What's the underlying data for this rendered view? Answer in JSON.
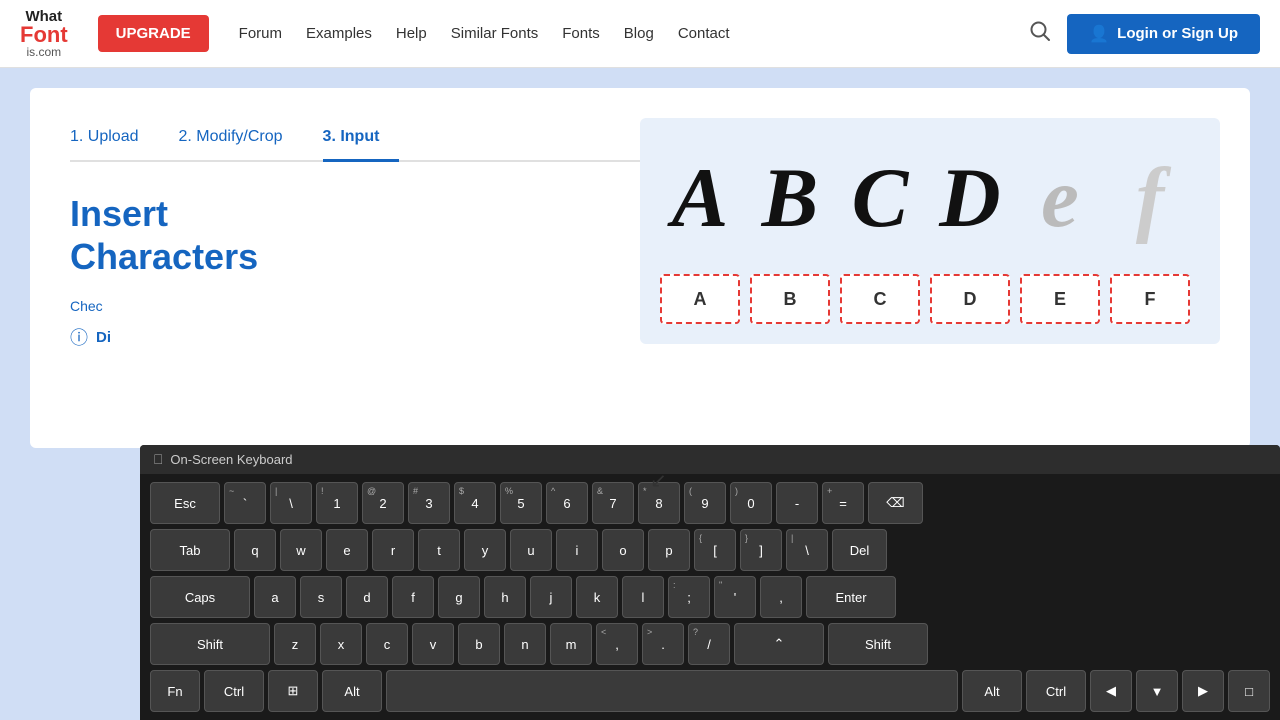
{
  "header": {
    "logo_what": "What",
    "logo_font": "Font",
    "logo_is": "is.com",
    "upgrade_label": "UPGRADE",
    "nav_items": [
      {
        "label": "Forum",
        "href": "#"
      },
      {
        "label": "Examples",
        "href": "#"
      },
      {
        "label": "Help",
        "href": "#"
      },
      {
        "label": "Similar Fonts",
        "href": "#"
      },
      {
        "label": "Fonts",
        "href": "#"
      },
      {
        "label": "Blog",
        "href": "#"
      },
      {
        "label": "Contact",
        "href": "#"
      }
    ],
    "login_label": "Login or Sign Up"
  },
  "steps": [
    {
      "label": "1. Upload",
      "active": false
    },
    {
      "label": "2. Modify/Crop",
      "active": false
    },
    {
      "label": "3. Input",
      "active": true
    }
  ],
  "main": {
    "title_line1": "Insert",
    "title_line2": "Characters",
    "check_text": "Chec",
    "di_text": "Di"
  },
  "char_panel": {
    "preview_chars": [
      {
        "char": "A",
        "faded": false
      },
      {
        "char": "B",
        "faded": false
      },
      {
        "char": "C",
        "faded": false
      },
      {
        "char": "D",
        "faded": false
      },
      {
        "char": "e",
        "faded": true
      },
      {
        "char": "f",
        "faded": true
      }
    ],
    "input_chars": [
      "A",
      "B",
      "C",
      "D",
      "E",
      "F"
    ]
  },
  "keyboard": {
    "title": "On-Screen Keyboard",
    "rows": [
      {
        "keys": [
          {
            "label": "Esc",
            "class": "wide"
          },
          {
            "label": "-",
            "sub": ""
          },
          {
            "label": "\\",
            "sub": ""
          },
          {
            "label": "1",
            "sub": "!"
          },
          {
            "label": "2",
            "sub": "@"
          },
          {
            "label": "3",
            "sub": "#"
          },
          {
            "label": "4",
            "sub": "$"
          },
          {
            "label": "5",
            "sub": "%"
          },
          {
            "label": "6",
            "sub": "^"
          },
          {
            "label": "7",
            "sub": "&"
          },
          {
            "label": "8",
            "sub": "*"
          },
          {
            "label": "9",
            "sub": "("
          },
          {
            "label": "0",
            "sub": ")"
          },
          {
            "label": "-",
            "sub": ""
          },
          {
            "label": "=",
            "sub": "+"
          },
          {
            "label": "⌫",
            "class": "backspace-key"
          }
        ]
      },
      {
        "keys": [
          {
            "label": "Tab",
            "class": "tab-key"
          },
          {
            "label": "q"
          },
          {
            "label": "w"
          },
          {
            "label": "e"
          },
          {
            "label": "r"
          },
          {
            "label": "t"
          },
          {
            "label": "y"
          },
          {
            "label": "u"
          },
          {
            "label": "i"
          },
          {
            "label": "o"
          },
          {
            "label": "p"
          },
          {
            "label": "{",
            "sub": "["
          },
          {
            "label": "}",
            "sub": "]"
          },
          {
            "label": "|",
            "sub": "\\"
          },
          {
            "label": "Del",
            "class": "del-key"
          }
        ]
      },
      {
        "keys": [
          {
            "label": "Caps",
            "class": "caps"
          },
          {
            "label": "a"
          },
          {
            "label": "s"
          },
          {
            "label": "d"
          },
          {
            "label": "f"
          },
          {
            "label": "g"
          },
          {
            "label": "h"
          },
          {
            "label": "j"
          },
          {
            "label": "k"
          },
          {
            "label": "l"
          },
          {
            "label": ":",
            "sub": ";"
          },
          {
            "label": "\"",
            "sub": "'"
          },
          {
            "label": ",",
            "sub": ""
          },
          {
            "label": "Enter",
            "class": "enter-key"
          }
        ]
      },
      {
        "keys": [
          {
            "label": "Shift",
            "class": "shift-l"
          },
          {
            "label": "z"
          },
          {
            "label": "x"
          },
          {
            "label": "c"
          },
          {
            "label": "v"
          },
          {
            "label": "b"
          },
          {
            "label": "n"
          },
          {
            "label": "m"
          },
          {
            "label": "<",
            "sub": ","
          },
          {
            "label": ">",
            "sub": "."
          },
          {
            "label": "?",
            "sub": "/"
          },
          {
            "label": "∧",
            "class": "wider"
          },
          {
            "label": "Shift",
            "class": "shift-r"
          }
        ]
      },
      {
        "keys": [
          {
            "label": "Fn",
            "class": "fn-key"
          },
          {
            "label": "Ctrl",
            "class": "ctrl-key"
          },
          {
            "label": "⊞",
            "class": "fn-key"
          },
          {
            "label": "Alt",
            "class": "alt-key"
          },
          {
            "label": "",
            "class": "space"
          },
          {
            "label": "Alt",
            "class": "alt-key"
          },
          {
            "label": "Ctrl",
            "class": "ctrl-key"
          },
          {
            "label": "◁"
          },
          {
            "label": "▽"
          },
          {
            "label": "▷"
          },
          {
            "label": "⬜"
          }
        ]
      }
    ]
  }
}
